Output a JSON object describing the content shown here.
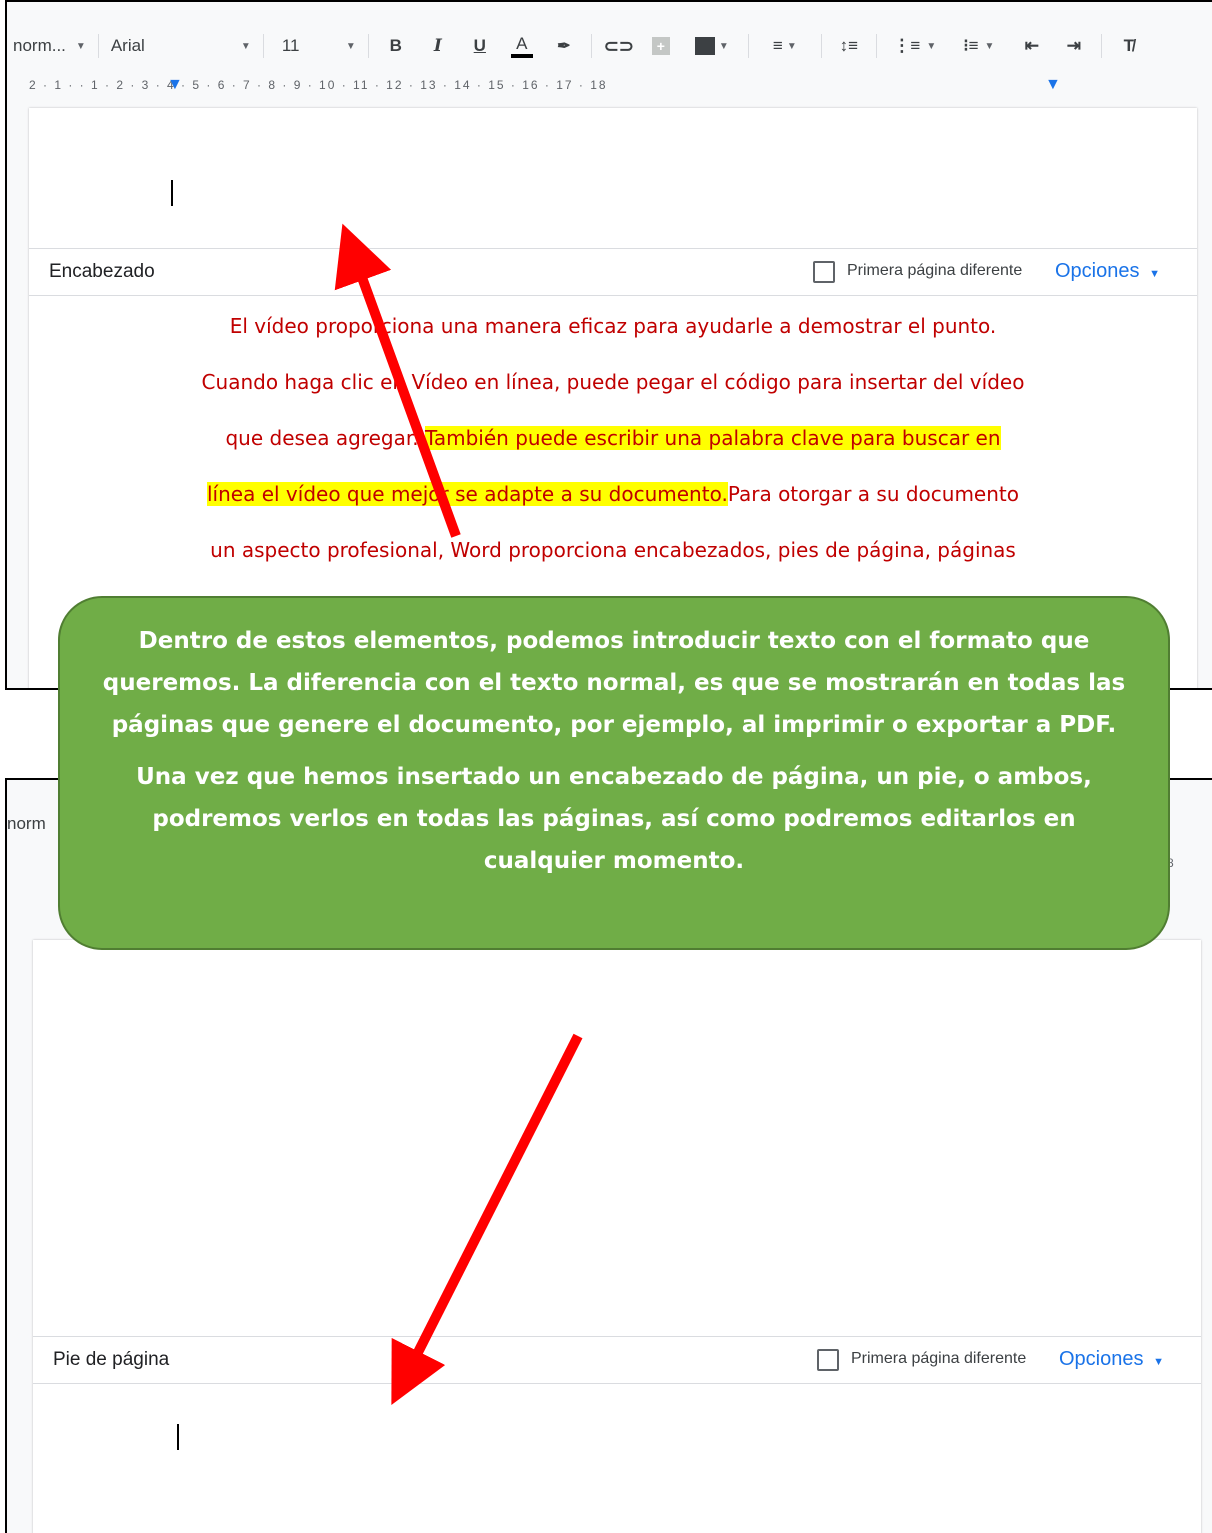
{
  "toolbar": {
    "style_select": "norm...",
    "font_select": "Arial",
    "font_size": "11",
    "bold": "B",
    "italic": "I",
    "underline": "U",
    "text_color": "A"
  },
  "ruler": {
    "marks": "2 · 1 · · 1 · 2 · 3 · 4 · 5 · 6 · 7 · 8 · 9 · 10 · 11 · 12 · 13 · 14 · 15 · 16 · 17 · 18"
  },
  "header": {
    "label": "Encabezado",
    "first_page_label": "Primera página diferente",
    "options_label": "Opciones"
  },
  "body": {
    "line1": "El vídeo proporciona una manera eficaz para ayudarle a demostrar el punto.",
    "line2": "Cuando haga clic en Vídeo en línea, puede pegar el código para insertar del vídeo",
    "line3a": "que desea agregar. ",
    "line3b": "También puede escribir una palabra clave para buscar en",
    "line4a": "línea el vídeo que mejor se adapte a su documento.",
    "line4b": "Para otorgar a su documento",
    "line5": "un aspecto profesional, Word proporciona encabezados, pies de página, páginas"
  },
  "callout": {
    "para1": "Dentro de estos elementos, podemos introducir texto con el formato que queremos. La diferencia con el texto normal, es que se mostrarán en todas las páginas que genere el documento, por ejemplo, al imprimir o exportar a PDF.",
    "para2": "Una vez que hemos insertado un encabezado de página, un pie, o ambos, podremos verlos en todas las páginas, así como podremos editarlos en cualquier momento."
  },
  "shot2": {
    "style_partial": "norm",
    "ruler_partial": "8"
  },
  "footer": {
    "label": "Pie de página",
    "first_page_label": "Primera página diferente",
    "options_label": "Opciones"
  },
  "colors": {
    "callout_bg": "#70ad47",
    "arrow": "#ff0000",
    "body_text": "#c00000",
    "highlight": "#ffff00",
    "link_blue": "#1a73e8"
  }
}
